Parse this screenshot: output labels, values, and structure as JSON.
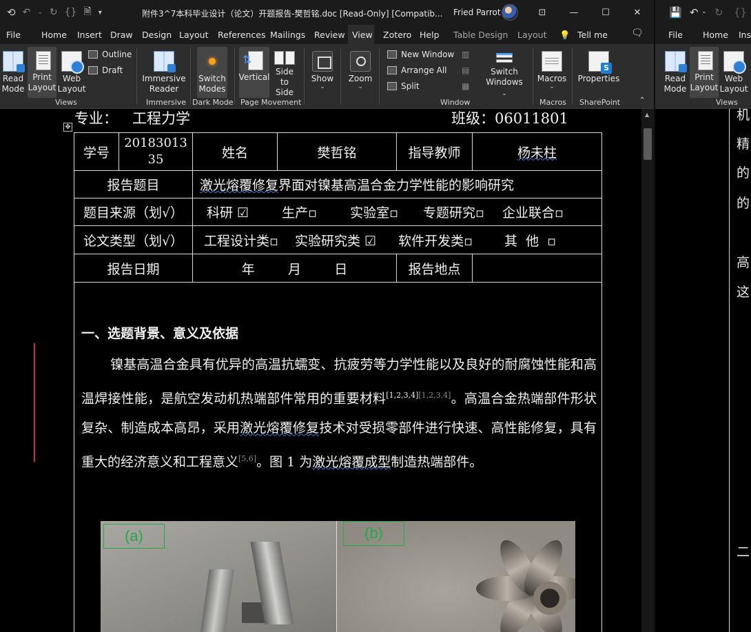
{
  "titlebar": {
    "doc_title": "附件3^7本科毕业设计（论文）开题报告-樊哲铭.doc [Read-Only] [Compatib...",
    "user_name": "Fried Parrot",
    "minimize": "—",
    "restore": "☐",
    "close": "✕",
    "ribbon_display": "⊡"
  },
  "tabs": [
    "File",
    "Home",
    "Insert",
    "Draw",
    "Design",
    "Layout",
    "References",
    "Mailings",
    "Review",
    "View",
    "Zotero",
    "Help",
    "Table Design",
    "Layout"
  ],
  "tell_me": "Tell me",
  "ribbon": {
    "views": {
      "read_mode": [
        "Read",
        "Mode"
      ],
      "print_layout": [
        "Print",
        "Layout"
      ],
      "web_layout": [
        "Web",
        "Layout"
      ],
      "outline": "Outline",
      "draft": "Draft",
      "group": "Views"
    },
    "immersive": {
      "reader": [
        "Immersive",
        "Reader"
      ],
      "group": "Immersive"
    },
    "dark_mode": {
      "switch": [
        "Switch",
        "Modes"
      ],
      "group": "Dark Mode"
    },
    "page_movement": {
      "vertical": "Vertical",
      "side": [
        "Side",
        "to Side"
      ],
      "group": "Page Movement"
    },
    "show": "Show",
    "zoom": "Zoom",
    "window": {
      "new_window": "New Window",
      "arrange_all": "Arrange All",
      "split": "Split",
      "switch_windows": [
        "Switch",
        "Windows"
      ],
      "group": "Window"
    },
    "macros": {
      "label": "Macros",
      "group": "Macros"
    },
    "sharepoint": {
      "properties": "Properties",
      "group": "SharePoint"
    }
  },
  "document": {
    "header_major_label": "专业：",
    "header_major_value": "工程力学",
    "header_class": "班级：06011801",
    "table": {
      "r1": {
        "c1": "学号",
        "c2a": "20183013",
        "c2b": "35",
        "c3": "姓名",
        "c4": "樊哲铭",
        "c5": "指导教师",
        "c6": "杨未柱"
      },
      "r2": {
        "label": "报告题目",
        "title_underlined": "激光熔覆修复",
        "title_rest": "界面对镍基高温合金力学性能的影响研究"
      },
      "r3": {
        "label": "题目来源（划√）",
        "o1": "科研 ☑",
        "o2": "生产▫",
        "o3": "实验室▫",
        "o4": "专题研究▫",
        "o5": "企业联合▫"
      },
      "r4": {
        "label": "论文类型（划√）",
        "o1": "工程设计类▫",
        "o2": "实验研究类 ☑",
        "o3": "软件开发类▫",
        "o4": "其  他  ▫"
      },
      "r5": {
        "label": "报告日期",
        "date": "年        月        日",
        "place_label": "报告地点"
      }
    },
    "section_title": "一、选题背景、意义及依据",
    "para": {
      "p1": "镍基高温合金具有优异的高温抗蠕变、抗疲劳等力学性能以及良好的耐腐蚀性能和高温焊接性能，是航空发动机热端部件常用的重要材料",
      "ref1": "[1,2,3,4]",
      "ref1_ghost": "[1,2,3,4]",
      "p2": "。高温合金热端部件形状复杂、制造成本高昂，采用",
      "link1": "激光熔覆修复",
      "p3": "技术对受损零部件进行快速、高性能修复，具有重大的经济意义和工程意义",
      "ref2": "[5,6]",
      "p4": "。图 1 为",
      "link2": "激光熔覆成型",
      "p5": "制造热端部件。"
    },
    "figure": {
      "label_a": "(a)",
      "label_b": "(b)"
    }
  },
  "right_window": {
    "tabs": [
      "File",
      "Home",
      "Inse"
    ],
    "views": {
      "read_mode": [
        "Read",
        "Mode"
      ],
      "print_layout": [
        "Print",
        "Layout"
      ],
      "web_layout": [
        "Web",
        "Layout"
      ],
      "group": "Views"
    },
    "text_lines": [
      "机",
      "精",
      "的",
      "的",
      "高",
      "这",
      "二"
    ]
  },
  "colors": {
    "accent": "#4a7bd6",
    "revision_bar": "#d43030",
    "figure_label": "#25a84a"
  }
}
